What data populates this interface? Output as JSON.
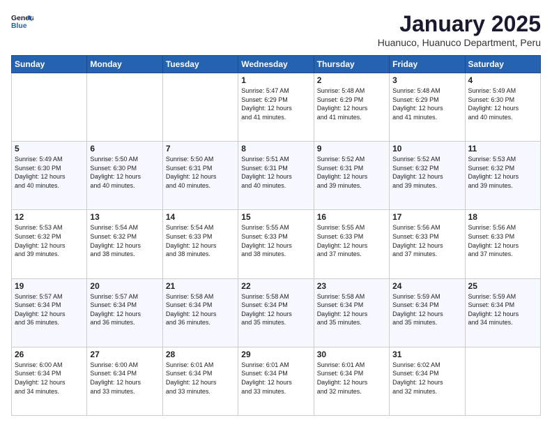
{
  "header": {
    "logo_line1": "General",
    "logo_line2": "Blue",
    "title": "January 2025",
    "subtitle": "Huanuco, Huanuco Department, Peru"
  },
  "weekdays": [
    "Sunday",
    "Monday",
    "Tuesday",
    "Wednesday",
    "Thursday",
    "Friday",
    "Saturday"
  ],
  "weeks": [
    [
      {
        "day": "",
        "info": ""
      },
      {
        "day": "",
        "info": ""
      },
      {
        "day": "",
        "info": ""
      },
      {
        "day": "1",
        "info": "Sunrise: 5:47 AM\nSunset: 6:29 PM\nDaylight: 12 hours\nand 41 minutes."
      },
      {
        "day": "2",
        "info": "Sunrise: 5:48 AM\nSunset: 6:29 PM\nDaylight: 12 hours\nand 41 minutes."
      },
      {
        "day": "3",
        "info": "Sunrise: 5:48 AM\nSunset: 6:29 PM\nDaylight: 12 hours\nand 41 minutes."
      },
      {
        "day": "4",
        "info": "Sunrise: 5:49 AM\nSunset: 6:30 PM\nDaylight: 12 hours\nand 40 minutes."
      }
    ],
    [
      {
        "day": "5",
        "info": "Sunrise: 5:49 AM\nSunset: 6:30 PM\nDaylight: 12 hours\nand 40 minutes."
      },
      {
        "day": "6",
        "info": "Sunrise: 5:50 AM\nSunset: 6:30 PM\nDaylight: 12 hours\nand 40 minutes."
      },
      {
        "day": "7",
        "info": "Sunrise: 5:50 AM\nSunset: 6:31 PM\nDaylight: 12 hours\nand 40 minutes."
      },
      {
        "day": "8",
        "info": "Sunrise: 5:51 AM\nSunset: 6:31 PM\nDaylight: 12 hours\nand 40 minutes."
      },
      {
        "day": "9",
        "info": "Sunrise: 5:52 AM\nSunset: 6:31 PM\nDaylight: 12 hours\nand 39 minutes."
      },
      {
        "day": "10",
        "info": "Sunrise: 5:52 AM\nSunset: 6:32 PM\nDaylight: 12 hours\nand 39 minutes."
      },
      {
        "day": "11",
        "info": "Sunrise: 5:53 AM\nSunset: 6:32 PM\nDaylight: 12 hours\nand 39 minutes."
      }
    ],
    [
      {
        "day": "12",
        "info": "Sunrise: 5:53 AM\nSunset: 6:32 PM\nDaylight: 12 hours\nand 39 minutes."
      },
      {
        "day": "13",
        "info": "Sunrise: 5:54 AM\nSunset: 6:32 PM\nDaylight: 12 hours\nand 38 minutes."
      },
      {
        "day": "14",
        "info": "Sunrise: 5:54 AM\nSunset: 6:33 PM\nDaylight: 12 hours\nand 38 minutes."
      },
      {
        "day": "15",
        "info": "Sunrise: 5:55 AM\nSunset: 6:33 PM\nDaylight: 12 hours\nand 38 minutes."
      },
      {
        "day": "16",
        "info": "Sunrise: 5:55 AM\nSunset: 6:33 PM\nDaylight: 12 hours\nand 37 minutes."
      },
      {
        "day": "17",
        "info": "Sunrise: 5:56 AM\nSunset: 6:33 PM\nDaylight: 12 hours\nand 37 minutes."
      },
      {
        "day": "18",
        "info": "Sunrise: 5:56 AM\nSunset: 6:33 PM\nDaylight: 12 hours\nand 37 minutes."
      }
    ],
    [
      {
        "day": "19",
        "info": "Sunrise: 5:57 AM\nSunset: 6:34 PM\nDaylight: 12 hours\nand 36 minutes."
      },
      {
        "day": "20",
        "info": "Sunrise: 5:57 AM\nSunset: 6:34 PM\nDaylight: 12 hours\nand 36 minutes."
      },
      {
        "day": "21",
        "info": "Sunrise: 5:58 AM\nSunset: 6:34 PM\nDaylight: 12 hours\nand 36 minutes."
      },
      {
        "day": "22",
        "info": "Sunrise: 5:58 AM\nSunset: 6:34 PM\nDaylight: 12 hours\nand 35 minutes."
      },
      {
        "day": "23",
        "info": "Sunrise: 5:58 AM\nSunset: 6:34 PM\nDaylight: 12 hours\nand 35 minutes."
      },
      {
        "day": "24",
        "info": "Sunrise: 5:59 AM\nSunset: 6:34 PM\nDaylight: 12 hours\nand 35 minutes."
      },
      {
        "day": "25",
        "info": "Sunrise: 5:59 AM\nSunset: 6:34 PM\nDaylight: 12 hours\nand 34 minutes."
      }
    ],
    [
      {
        "day": "26",
        "info": "Sunrise: 6:00 AM\nSunset: 6:34 PM\nDaylight: 12 hours\nand 34 minutes."
      },
      {
        "day": "27",
        "info": "Sunrise: 6:00 AM\nSunset: 6:34 PM\nDaylight: 12 hours\nand 33 minutes."
      },
      {
        "day": "28",
        "info": "Sunrise: 6:01 AM\nSunset: 6:34 PM\nDaylight: 12 hours\nand 33 minutes."
      },
      {
        "day": "29",
        "info": "Sunrise: 6:01 AM\nSunset: 6:34 PM\nDaylight: 12 hours\nand 33 minutes."
      },
      {
        "day": "30",
        "info": "Sunrise: 6:01 AM\nSunset: 6:34 PM\nDaylight: 12 hours\nand 32 minutes."
      },
      {
        "day": "31",
        "info": "Sunrise: 6:02 AM\nSunset: 6:34 PM\nDaylight: 12 hours\nand 32 minutes."
      },
      {
        "day": "",
        "info": ""
      }
    ]
  ]
}
